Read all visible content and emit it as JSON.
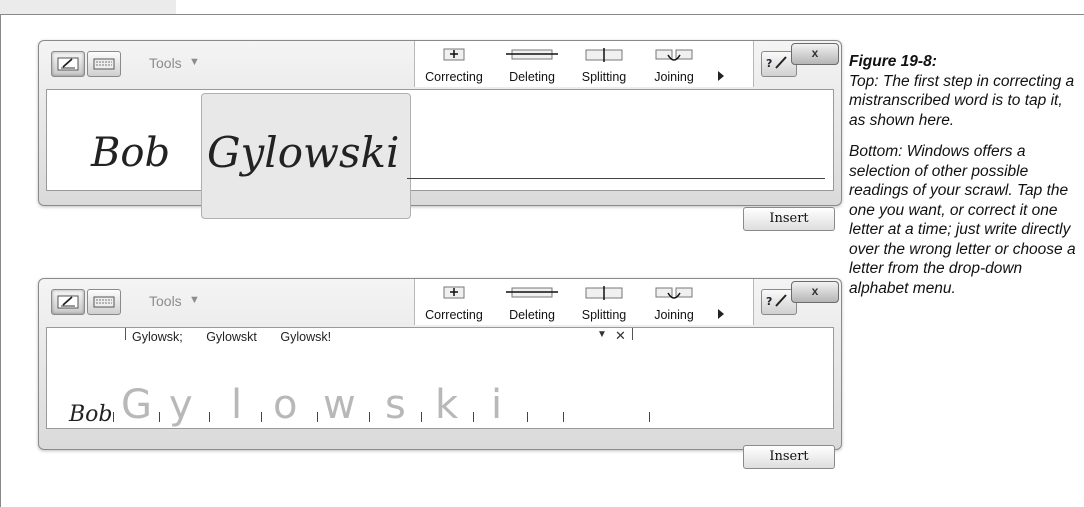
{
  "figure": {
    "label": "Figure 19-8:",
    "caption_top": "Top: The first step in correcting a mistranscribed word is to tap it, as shown here.",
    "caption_bottom": "Bottom: Windows offers a selection of other possible readings of your scrawl. Tap the one you want, or correct it one letter at a time; just write directly over the wrong letter or choose a letter from the drop-down alphabet menu."
  },
  "toolbar": {
    "tools_label": "Tools",
    "gestures": [
      "Correcting",
      "Deleting",
      "Splitting",
      "Joining"
    ],
    "close_label": "x",
    "insert_label": "Insert"
  },
  "top_panel": {
    "word1": "Bob",
    "word2": "Gylowski"
  },
  "bottom_panel": {
    "bob": "Bob",
    "alternatives": [
      "Gylowsk;",
      "Gylowskt",
      "Gylowsk!"
    ],
    "letters": [
      "G",
      "y",
      "l",
      "o",
      "w",
      "s",
      "k",
      "i"
    ]
  },
  "icons": {
    "pen": "pen-writing-icon",
    "keyboard": "keyboard-icon",
    "tools_dropdown": "chevron-down-icon",
    "help": "help-pen-icon",
    "close": "close-icon",
    "expand": "triangle-right-icon"
  }
}
